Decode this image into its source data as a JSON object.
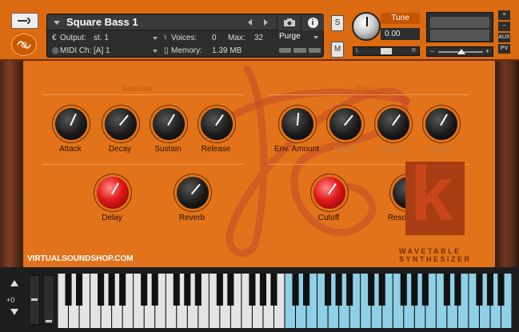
{
  "header": {
    "instrument_name": "Square Bass 1",
    "output_label": "Output:",
    "output_value": "st. 1",
    "voices_label": "Voices:",
    "voices_value": "0",
    "max_label": "Max:",
    "max_value": "32",
    "purge_label": "Purge",
    "midi_label": "MIDI Ch:",
    "midi_value": "[A]  1",
    "memory_label": "Memory:",
    "memory_value": "1.39 MB",
    "solo_label": "S",
    "mute_label": "M",
    "tune_label": "Tune",
    "tune_value": "0.00",
    "pan_left": "L",
    "pan_right": "R",
    "vol_minus": "−",
    "vol_plus": "+",
    "close": "×",
    "minimize": "−",
    "aux": "AUX",
    "pv": "PV"
  },
  "amplifier": {
    "title": "Amplifier",
    "knobs": [
      {
        "label": "Attack",
        "angle": 25
      },
      {
        "label": "Decay",
        "angle": 40
      },
      {
        "label": "Sustain",
        "angle": 30
      },
      {
        "label": "Release",
        "angle": 35
      }
    ]
  },
  "filter": {
    "title": "Filter",
    "knobs": [
      {
        "label": "Env. Amount",
        "angle": 5,
        "dim": false
      },
      {
        "label": "Attack",
        "angle": 40,
        "dim": true
      },
      {
        "label": "Decay",
        "angle": 35,
        "dim": true
      },
      {
        "label": "Release",
        "angle": 30,
        "dim": true
      }
    ]
  },
  "effects": {
    "knobs": [
      {
        "label": "Delay",
        "angle": 30,
        "color": "red"
      },
      {
        "label": "Reverb",
        "angle": 40,
        "color": "black"
      },
      {
        "label": "Cutoff",
        "angle": 35,
        "color": "red"
      },
      {
        "label": "Resonance",
        "angle": 40,
        "color": "black"
      }
    ]
  },
  "branding": {
    "line1": "WAVETABLE",
    "line2": "SYNTHESIZER",
    "site": "VIRTUALSOUNDSHOP.COM"
  },
  "keyboard": {
    "octave_label": "+0",
    "white_keys": 42,
    "highlight_from_white": 21
  },
  "colors": {
    "panel": "#e2731a",
    "header": "#dc6a10",
    "key_highlight": "#8fd0e6",
    "key_white": "#e4e4e4"
  }
}
